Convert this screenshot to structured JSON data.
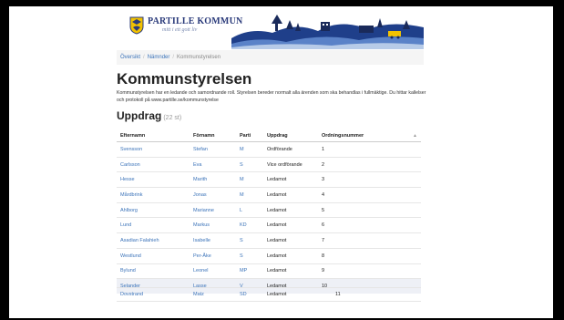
{
  "header": {
    "org_name": "PARTILLE KOMMUN",
    "slogan": "mitt i ett gott liv"
  },
  "breadcrumb": {
    "items": [
      "Översikt",
      "Nämnder"
    ],
    "current": "Kommunstyrelsen"
  },
  "page": {
    "title": "Kommunstyrelsen",
    "description": "Kommunstyrelsen har en ledande och samordnande roll. Styrelsen bereder normalt alla ärenden som ska behandlas i fullmäktige. Du hittar kallelser och protokoll på www.partille.se/kommunstyrelse"
  },
  "section": {
    "title": "Uppdrag",
    "count": "(22 st)"
  },
  "table": {
    "columns": [
      "Efternamn",
      "Förnamn",
      "Parti",
      "Uppdrag",
      "Ordningsnummer"
    ],
    "rows": [
      {
        "efternamn": "Svensson",
        "fornamn": "Stefan",
        "parti": "M",
        "uppdrag": "Ordförande",
        "nr": "1"
      },
      {
        "efternamn": "Carlsson",
        "fornamn": "Eva",
        "parti": "S",
        "uppdrag": "Vice ordförande",
        "nr": "2"
      },
      {
        "efternamn": "Hesse",
        "fornamn": "Marith",
        "parti": "M",
        "uppdrag": "Ledamot",
        "nr": "3"
      },
      {
        "efternamn": "Mårdbrink",
        "fornamn": "Jonas",
        "parti": "M",
        "uppdrag": "Ledamot",
        "nr": "4"
      },
      {
        "efternamn": "Ahlborg",
        "fornamn": "Marianne",
        "parti": "L",
        "uppdrag": "Ledamot",
        "nr": "5"
      },
      {
        "efternamn": "Lund",
        "fornamn": "Markus",
        "parti": "KD",
        "uppdrag": "Ledamot",
        "nr": "6"
      },
      {
        "efternamn": "Asadian Falahieh",
        "fornamn": "Isabelle",
        "parti": "S",
        "uppdrag": "Ledamot",
        "nr": "7"
      },
      {
        "efternamn": "Westlund",
        "fornamn": "Per-Åke",
        "parti": "S",
        "uppdrag": "Ledamot",
        "nr": "8"
      },
      {
        "efternamn": "Bylund",
        "fornamn": "Leonel",
        "parti": "MP",
        "uppdrag": "Ledamot",
        "nr": "9"
      },
      {
        "efternamn": "Selander",
        "fornamn": "Lasse",
        "parti": "V",
        "uppdrag": "Ledamot",
        "nr": "10"
      },
      {
        "efternamn": "Dovstrand",
        "fornamn": "Matz",
        "parti": "SD",
        "uppdrag": "Ledamot",
        "nr": "11"
      }
    ]
  },
  "colors": {
    "link": "#3b73b9",
    "header_blue": "#2a3a7a",
    "row_highlight": "#eef0f6"
  }
}
